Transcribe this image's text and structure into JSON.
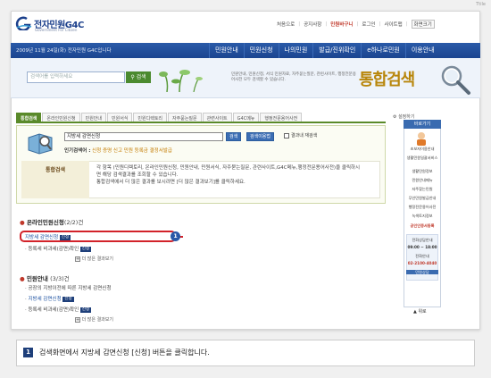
{
  "corner_tag": "Ttile",
  "header": {
    "logo_title": "전자민원G4C",
    "logo_subtitle": "Government For Citizen",
    "util": [
      "처음으로",
      "공지사항",
      "민원바구니",
      "로그인",
      "사이트맵",
      "화면크기"
    ],
    "util_highlight_index": 2
  },
  "navbar": {
    "date": "2009년 11월 24일(화) 전자민원 G4C입니다",
    "menu": [
      "민원안내",
      "민원신청",
      "나의민원",
      "발급/진위확인",
      "e하나로민원",
      "이용안내"
    ]
  },
  "search": {
    "placeholder": "검색어를 입력하세요",
    "button": "검색",
    "description": "민원안내, 민원신청, 서식 민원자료, 자주묻는질문, 관련사이트, 행정전문용어사전 모두 검색할 수 있습니다.",
    "big_title": "통합검색"
  },
  "tabs": {
    "items": [
      "통합검색",
      "온라인민원신청",
      "민원안내",
      "민원서식",
      "민원디렉토리",
      "자주묻는질문",
      "관련사이트",
      "G4C메뉴",
      "행정전문용어사전"
    ],
    "active_index": 0,
    "settings": "설정하기"
  },
  "query": {
    "value": "지방세 감면신청",
    "button_search": "검색",
    "button_help": "검색이용법",
    "checkbox_label": "결과내 재검색",
    "popular_label": "인기검색어 :",
    "popular_keywords": "신청  증명  신고  민원  등록금  결정서발급"
  },
  "info": {
    "heading": "통합검색",
    "lines": [
      "각 항목 (민원디렉토리, 온라인민원신청, 민원안내, 민원서식, 자주묻는질문, 관련사이트,G4C메뉴,행정전문용어사전)을 클릭하시",
      "면 해당 검색결과를 조회할 수 있습니다.",
      "통합검색에서 더 많은 결과를 보시려면 [더 많은 결과보기]를 클릭하세요."
    ]
  },
  "results": {
    "section1": {
      "title": "온라인민원신청",
      "count": "(2/2)건"
    },
    "section1_items": [
      {
        "text": "지방세 감면신청",
        "badge": "신청"
      },
      {
        "text": "등록세 비과세(감면)확인",
        "badge": "신청"
      }
    ],
    "section1_more": "더 많은 결과보기",
    "section2": {
      "title": "민원안내",
      "count": "(3/3)건"
    },
    "section2_items": [
      {
        "text": "공장의 지방이전에 따른 지방세 감면신청",
        "badge": ""
      },
      {
        "text": "지방세 감면신청",
        "badge": "신청"
      },
      {
        "text": "등록세 비과세(감면)확인",
        "badge": "신청"
      }
    ],
    "section2_more": "더 많은 결과보기",
    "callout_number": "1"
  },
  "sidebar": {
    "title": "바로가기",
    "items": [
      "초보자이용안내",
      "생활민원일괄서비스",
      "생활민원정보",
      "민원안내메뉴",
      "자주찾는민원",
      "무인민원발급안내",
      "행정전문용어사전",
      "녹색토지정보",
      "공인인증서등록",
      "전화상담안내",
      "09:00 ~ 18:00",
      "전화안내",
      "02-2100-4040",
      "민원상담"
    ],
    "highlight_indices": [
      8,
      12
    ],
    "top_button": "위로"
  },
  "caption": {
    "number": "1",
    "text": "검색화면에서 지방세 감면신청 [신청] 버튼을 클릭합니다."
  }
}
